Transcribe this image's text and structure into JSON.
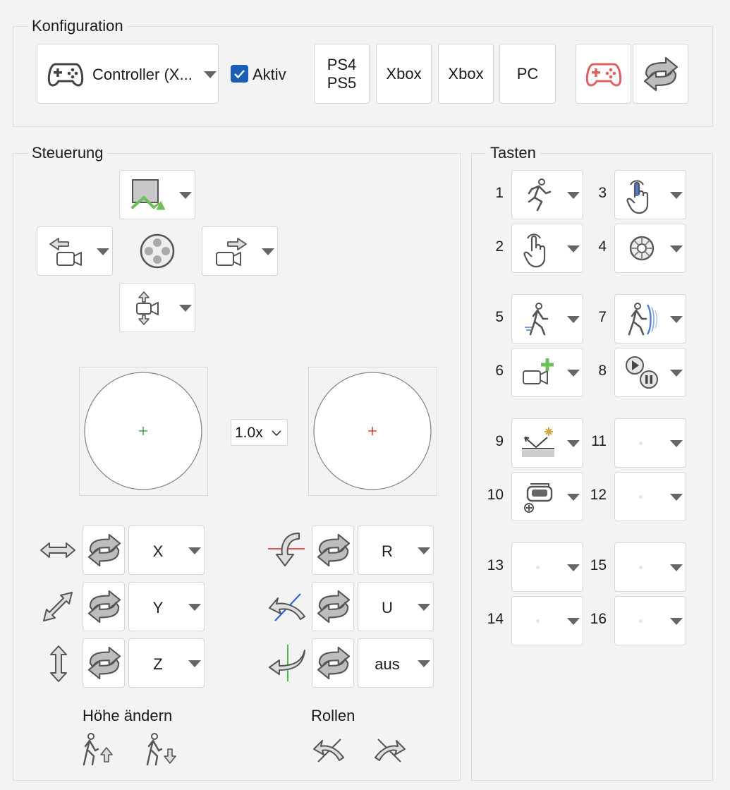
{
  "config": {
    "title": "Konfiguration",
    "controller_select": "Controller (X...",
    "active_label": "Aktiv",
    "active_checked": true,
    "preset_buttons": [
      "PS4\nPS5",
      "Xbox",
      "Xbox",
      "PC"
    ],
    "gamepad_color": "#e06060"
  },
  "steuerung": {
    "title": "Steuerung",
    "zoom": "1.0x",
    "left_axes": [
      "X",
      "Y",
      "Z"
    ],
    "right_axes": [
      "R",
      "U",
      "aus"
    ],
    "height_label": "Höhe ändern",
    "roll_label": "Rollen"
  },
  "tasten": {
    "title": "Tasten",
    "numbers": [
      "1",
      "2",
      "3",
      "4",
      "5",
      "6",
      "7",
      "8",
      "9",
      "10",
      "11",
      "12",
      "13",
      "14",
      "15",
      "16"
    ]
  }
}
